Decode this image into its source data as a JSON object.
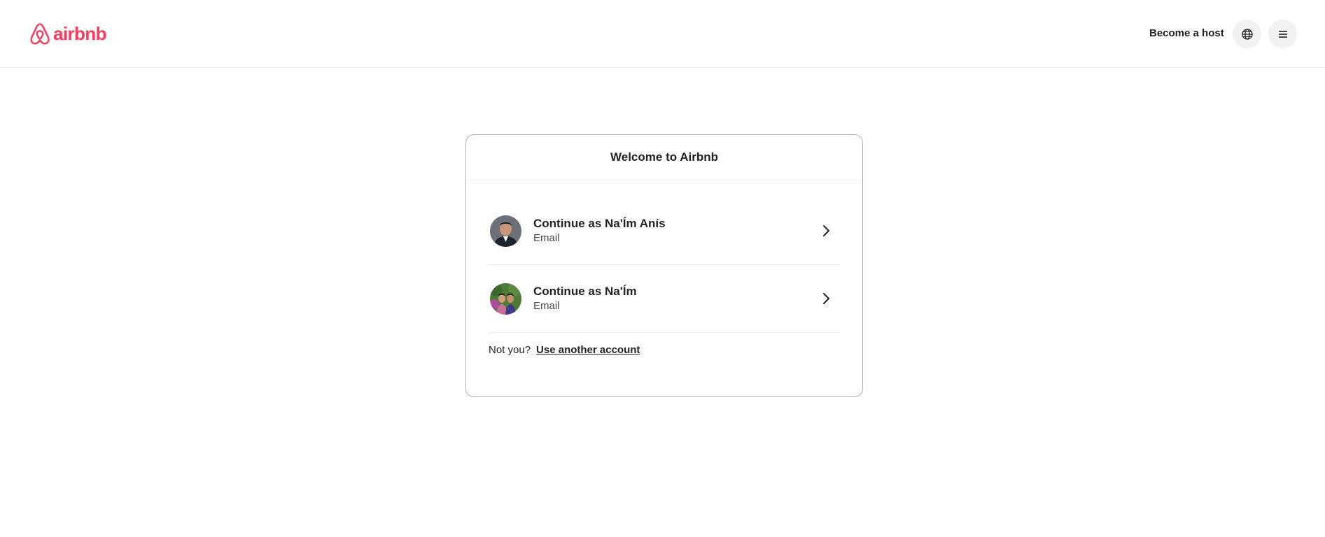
{
  "header": {
    "logo_text": "airbnb",
    "become_host_label": "Become a host",
    "language_icon": "globe-icon",
    "menu_icon": "hamburger-menu-icon"
  },
  "card": {
    "title": "Welcome to Airbnb",
    "accounts": [
      {
        "name": "Continue as Na'Ím Anís",
        "type": "Email",
        "avatar_icon": "profile-photo-man-suit"
      },
      {
        "name": "Continue as Na'Ím",
        "type": "Email",
        "avatar_icon": "profile-photo-group-outdoors"
      }
    ],
    "not_you_label": "Not you?",
    "use_another_label": "Use another account"
  },
  "colors": {
    "brand": "#ff385c",
    "text": "#222222",
    "border": "#b0b0b0",
    "divider": "#ebebeb"
  }
}
